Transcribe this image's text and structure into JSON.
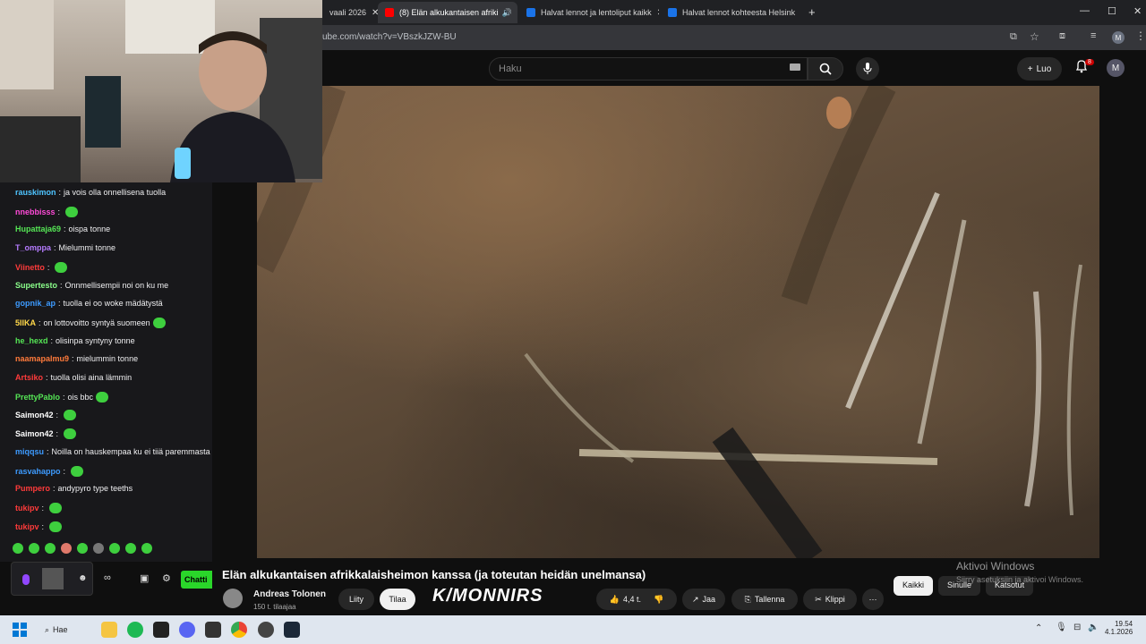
{
  "browser": {
    "tabs": [
      {
        "label": "vaali 2026"
      },
      {
        "label": "(8) Elän alkukantaisen afriki"
      },
      {
        "label": "Halvat lennot ja lentoliput kaikk"
      },
      {
        "label": "Halvat lennot kohteesta Helsink"
      }
    ],
    "url": "ube.com/watch?v=VBszkJZW-BU",
    "profile_letter": "M"
  },
  "youtube": {
    "search_placeholder": "Haku",
    "create_label": "Luo",
    "notifications": "8",
    "avatar_letter": "M",
    "video_title": "Elän alkukantaisen afrikkalaisheimon kanssa (ja toteutan heidän unelmansa)",
    "channel_name": "Andreas Tolonen",
    "subscribers": "150 t. tilaajaa",
    "join_label": "Liity",
    "subscribe_label": "Tilaa",
    "sponsor_text": "K/MONNIRS",
    "likes": "4,4 t.",
    "share_label": "Jaa",
    "save_label": "Tallenna",
    "clip_label": "Klippi",
    "filters": [
      "Kaikki",
      "Sinulle",
      "Katsotut"
    ]
  },
  "windows_watermark": {
    "line1": "Aktivoi Windows",
    "line2": "Siirry asetuksiin ja aktivoi Windows."
  },
  "chat": {
    "messages": [
      {
        "user": "rauskimon",
        "color": "#4ec4ff",
        "text": "ja vois olla onnellisena tuolla",
        "emote": false
      },
      {
        "user": "nnebbisss",
        "color": "#ff4ad8",
        "text": "",
        "emote": true
      },
      {
        "user": "Hupattaja69",
        "color": "#55e655",
        "text": "oispa tonne",
        "emote": false
      },
      {
        "user": "T_omppa",
        "color": "#b57bff",
        "text": "Mielummi tonne",
        "emote": false
      },
      {
        "user": "Viinetto",
        "color": "#ff3b3b",
        "text": "",
        "emote": true
      },
      {
        "user": "Supertesto",
        "color": "#8bff8b",
        "text": "Onnmellisempii noi on ku me",
        "emote": false
      },
      {
        "user": "gopnik_ap",
        "color": "#3d9bff",
        "text": "tuolla ei oo woke mädätystä",
        "emote": false
      },
      {
        "user": "5IIKA",
        "color": "#ffd84a",
        "text": "on lottovoitto syntyä suomeen",
        "emote": true
      },
      {
        "user": "he_hexd",
        "color": "#55e655",
        "text": "olisinpa syntyny tonne",
        "emote": false
      },
      {
        "user": "naamapalmu9",
        "color": "#ff7a3b",
        "text": "mielummin tonne",
        "emote": false
      },
      {
        "user": "Artsiko",
        "color": "#ff3b3b",
        "text": "tuolla olisi aina lämmin",
        "emote": false
      },
      {
        "user": "PrettyPablo",
        "color": "#55e655",
        "text": "ois bbc",
        "emote": true
      },
      {
        "user": "Saimon42",
        "color": "#ffffff",
        "text": "",
        "emote": true
      },
      {
        "user": "Saimon42",
        "color": "#ffffff",
        "text": "",
        "emote": true
      },
      {
        "user": "miqqsu",
        "color": "#3d9bff",
        "text": "Noilla on hauskempaa ku ei tiiä paremmasta",
        "emote": false
      },
      {
        "user": "rasvahappo",
        "color": "#3d9bff",
        "text": "",
        "emote": true
      },
      {
        "user": "Pumpero",
        "color": "#ff3b3b",
        "text": "andypyro type teeths",
        "emote": false
      },
      {
        "user": "tukipv",
        "color": "#ff3b3b",
        "text": "",
        "emote": true
      },
      {
        "user": "tukipv",
        "color": "#ff3b3b",
        "text": "",
        "emote": true
      }
    ],
    "send_label": "Chatti"
  },
  "taskbar": {
    "search_label": "Hae",
    "time": "19.54",
    "date": "4.1.2026"
  }
}
